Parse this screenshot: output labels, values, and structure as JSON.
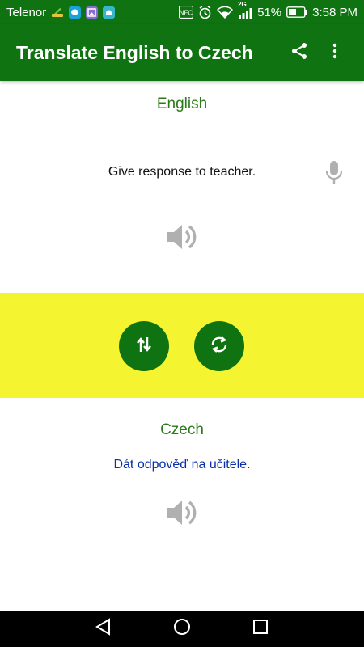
{
  "status_bar": {
    "carrier": "Telenor",
    "network": "2G",
    "battery": "51%",
    "time": "3:58 PM",
    "nfc": "NFC",
    "icons": [
      "broom-icon",
      "chat-icon",
      "image-icon",
      "android-icon",
      "nfc-icon",
      "alarm-icon",
      "wifi-icon",
      "signal-icon",
      "battery-icon"
    ]
  },
  "app_bar": {
    "title": "Translate English to Czech",
    "actions": [
      "share-icon",
      "more-vert-icon"
    ]
  },
  "source": {
    "language": "English",
    "text": "Give response to teacher."
  },
  "controls": {
    "buttons": [
      "swap-icon",
      "refresh-icon"
    ],
    "band_color": "#f4f430"
  },
  "target": {
    "language": "Czech",
    "text": "Dát odpověď na učitele."
  },
  "colors": {
    "primary": "#0e7310",
    "language_label": "#2c7a19",
    "translation_text": "#0a2fa8",
    "icon_gray": "#b0b0b0"
  },
  "nav_bar": {
    "buttons": [
      "back-icon",
      "home-icon",
      "recents-icon"
    ]
  }
}
